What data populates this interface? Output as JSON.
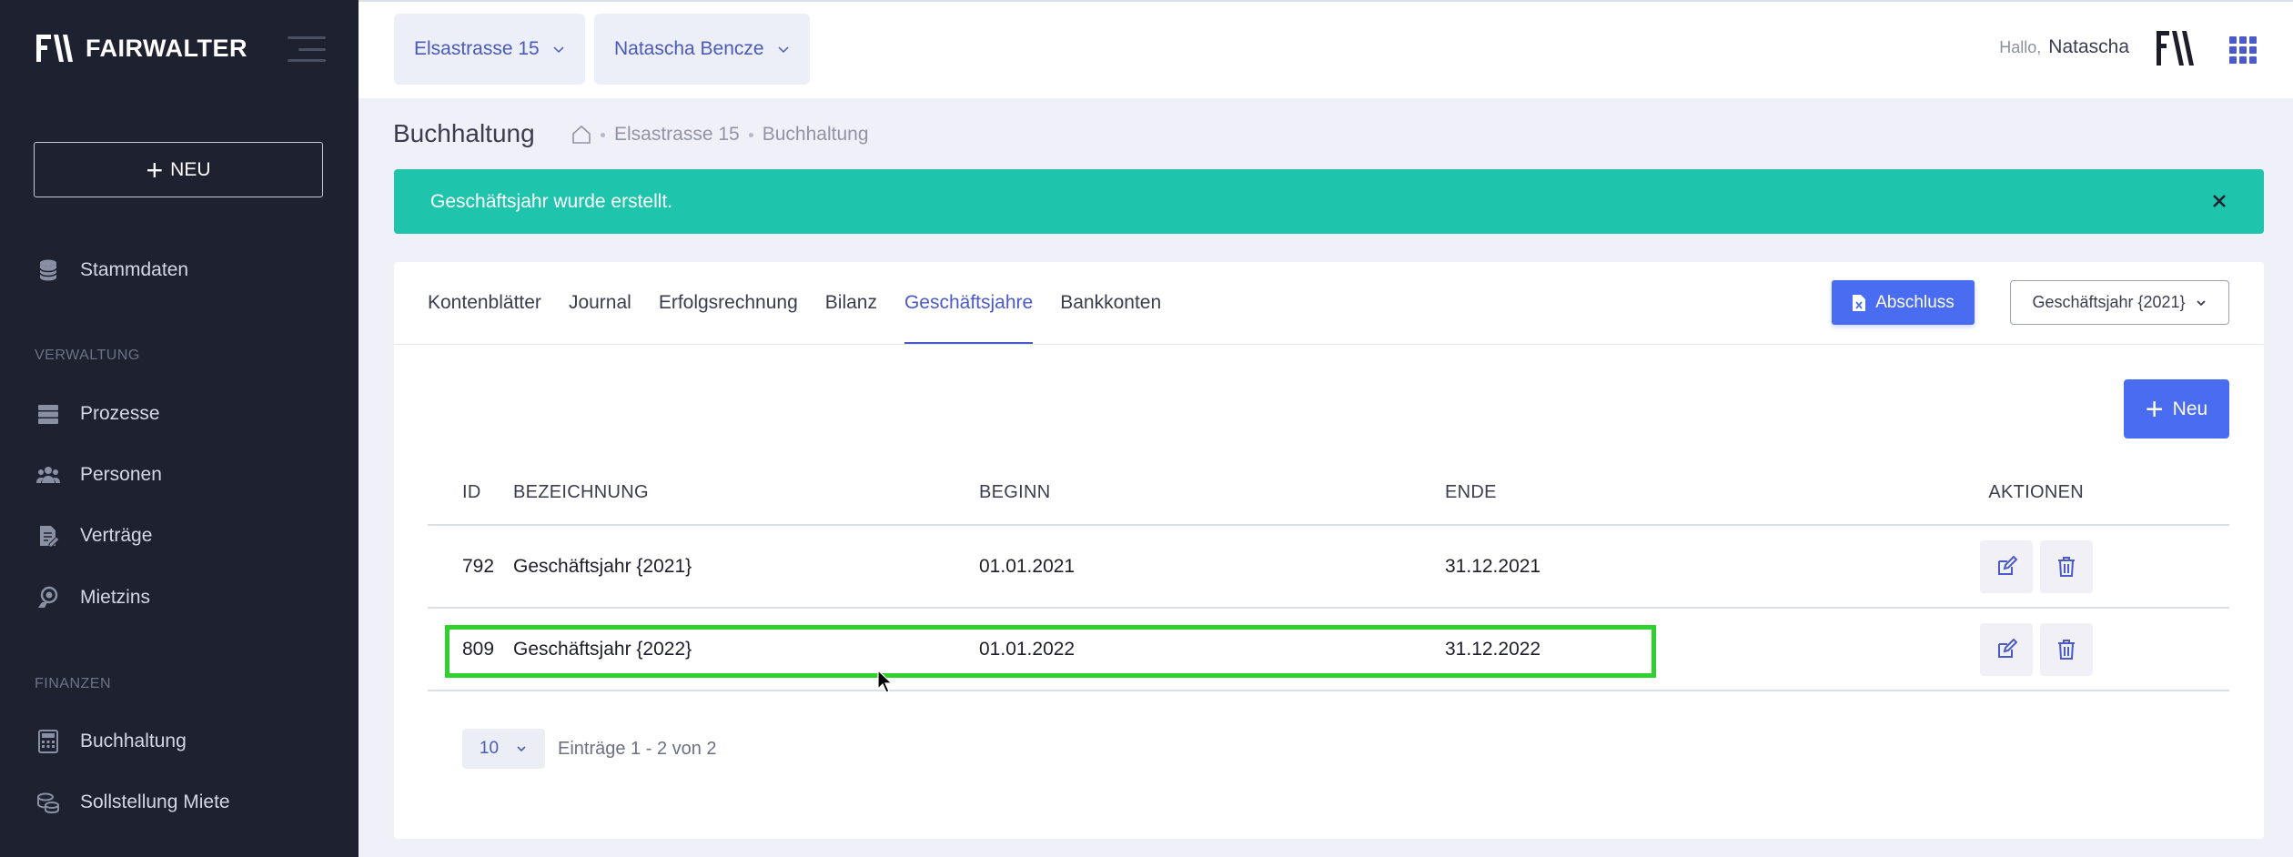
{
  "app": {
    "brand": "FAIRWALTER"
  },
  "sidebar": {
    "new_label": "NEU",
    "stammdaten": "Stammdaten",
    "section_verwaltung": "VERWALTUNG",
    "section_finanzen": "FINANZEN",
    "items": {
      "prozesse": "Prozesse",
      "personen": "Personen",
      "vertraege": "Verträge",
      "mietzins": "Mietzins",
      "buchhaltung": "Buchhaltung",
      "sollstellung": "Sollstellung Miete"
    }
  },
  "topbar": {
    "property": "Elsastrasse 15",
    "user_select": "Natascha Bencze",
    "greeting": "Hallo,",
    "user_name": "Natascha"
  },
  "page": {
    "title": "Buchhaltung",
    "breadcrumb": [
      "Elsastrasse 15",
      "Buchhaltung"
    ]
  },
  "alert": {
    "message": "Geschäftsjahr wurde erstellt."
  },
  "tabs": [
    "Kontenblätter",
    "Journal",
    "Erfolgsrechnung",
    "Bilanz",
    "Geschäftsjahre",
    "Bankkonten"
  ],
  "active_tab": "Geschäftsjahre",
  "toolbar": {
    "abschluss_label": "Abschluss",
    "year_select": "Geschäftsjahr {2021}",
    "neu_label": "Neu"
  },
  "table": {
    "headers": {
      "id": "ID",
      "bez": "BEZEICHNUNG",
      "beg": "BEGINN",
      "end": "ENDE",
      "akt": "AKTIONEN"
    },
    "rows": [
      {
        "id": "792",
        "bez": "Geschäftsjahr {2021}",
        "beg": "01.01.2021",
        "end": "31.12.2021"
      },
      {
        "id": "809",
        "bez": "Geschäftsjahr {2022}",
        "beg": "01.01.2022",
        "end": "31.12.2022"
      }
    ]
  },
  "pager": {
    "per_page": "10",
    "entries": "Einträge 1 - 2 von 2"
  },
  "colors": {
    "accent": "#4a6cf0",
    "success": "#1fc4ac",
    "sidebar_bg": "#1e2230",
    "highlight": "#2ed12e"
  }
}
